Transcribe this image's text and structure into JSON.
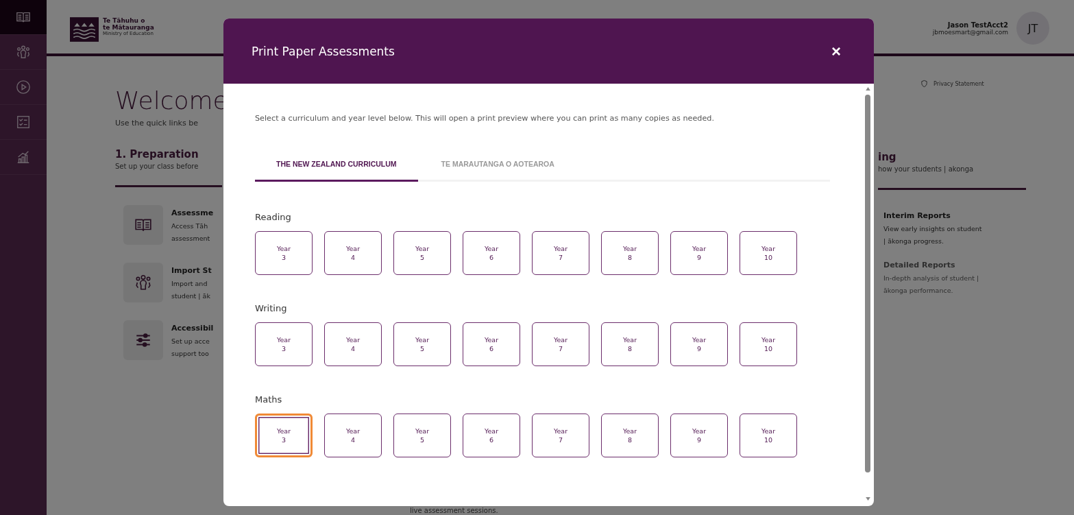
{
  "sidebar": {
    "items": [
      {
        "kind": "book",
        "selected": true
      },
      {
        "kind": "people",
        "selected": false
      },
      {
        "kind": "play",
        "selected": false
      },
      {
        "kind": "checklist",
        "selected": false
      },
      {
        "kind": "chart",
        "selected": false
      }
    ]
  },
  "header": {
    "logo": {
      "line_1": "Te Tāhuhu o",
      "line_2": "te Mātauranga",
      "line_3": "Ministry of Education"
    },
    "user": {
      "name": "Jason TestAcct2",
      "email": "jbmoesmart@gmail.com",
      "initials": "JT"
    }
  },
  "privacy_link": "Privacy Statement",
  "welcome": {
    "title": "Welcome",
    "subtitle": "Use the quick links be"
  },
  "preparation": {
    "title": "1. Preparation",
    "subtitle": "Set up your class before",
    "items": [
      {
        "kind": "book",
        "title": "Assessme",
        "lines": [
          "Access Tāh",
          "assessment"
        ],
        "disabled": false
      },
      {
        "kind": "people",
        "title": "Import St",
        "lines": [
          "Import and",
          "student | āk"
        ],
        "disabled": false
      },
      {
        "kind": "sliders",
        "title": "Accessibil",
        "lines": [
          "Set up acce",
          "support too"
        ],
        "disabled": false
      }
    ]
  },
  "reporting": {
    "title": "ing",
    "subtitle": "how your students | akonga",
    "items": [
      {
        "title": "Interim Reports",
        "lines": [
          "View early insights on student",
          "| ākonga progress."
        ],
        "disabled": false
      },
      {
        "title": "Detailed Reports",
        "lines": [
          "In-depth analysis of student |",
          "ākonga performance."
        ],
        "disabled": true
      }
    ]
  },
  "footer_text": "live assessment sessions.",
  "dialog": {
    "title": "Print Paper Assessments",
    "close": "×",
    "intro": "Select a curriculum and year level below. This will open a print preview where you can print as many copies as needed.",
    "tabs": [
      {
        "label": "THE NEW ZEALAND CURRICULUM",
        "selected": true
      },
      {
        "label": "TE MARAUTANGA O AOTEAROA",
        "selected": false
      }
    ],
    "sections": [
      {
        "title": "Reading",
        "years": [
          {
            "label": "Year 3",
            "focused": false
          },
          {
            "label": "Year 4",
            "focused": false
          },
          {
            "label": "Year 5",
            "focused": false
          },
          {
            "label": "Year 6",
            "focused": false
          },
          {
            "label": "Year 7",
            "focused": false
          },
          {
            "label": "Year 8",
            "focused": false
          },
          {
            "label": "Year 9",
            "focused": false
          },
          {
            "label": "Year 10",
            "focused": false
          }
        ]
      },
      {
        "title": "Writing",
        "years": [
          {
            "label": "Year 3",
            "focused": false
          },
          {
            "label": "Year 4",
            "focused": false
          },
          {
            "label": "Year 5",
            "focused": false
          },
          {
            "label": "Year 6",
            "focused": false
          },
          {
            "label": "Year 7",
            "focused": false
          },
          {
            "label": "Year 8",
            "focused": false
          },
          {
            "label": "Year 9",
            "focused": false
          },
          {
            "label": "Year 10",
            "focused": false
          }
        ]
      },
      {
        "title": "Maths",
        "years": [
          {
            "label": "Year 3",
            "focused": true
          },
          {
            "label": "Year 4",
            "focused": false
          },
          {
            "label": "Year 5",
            "focused": false
          },
          {
            "label": "Year 6",
            "focused": false
          },
          {
            "label": "Year 7",
            "focused": false
          },
          {
            "label": "Year 8",
            "focused": false
          },
          {
            "label": "Year 9",
            "focused": false
          },
          {
            "label": "Year 10",
            "focused": false
          }
        ]
      }
    ]
  }
}
